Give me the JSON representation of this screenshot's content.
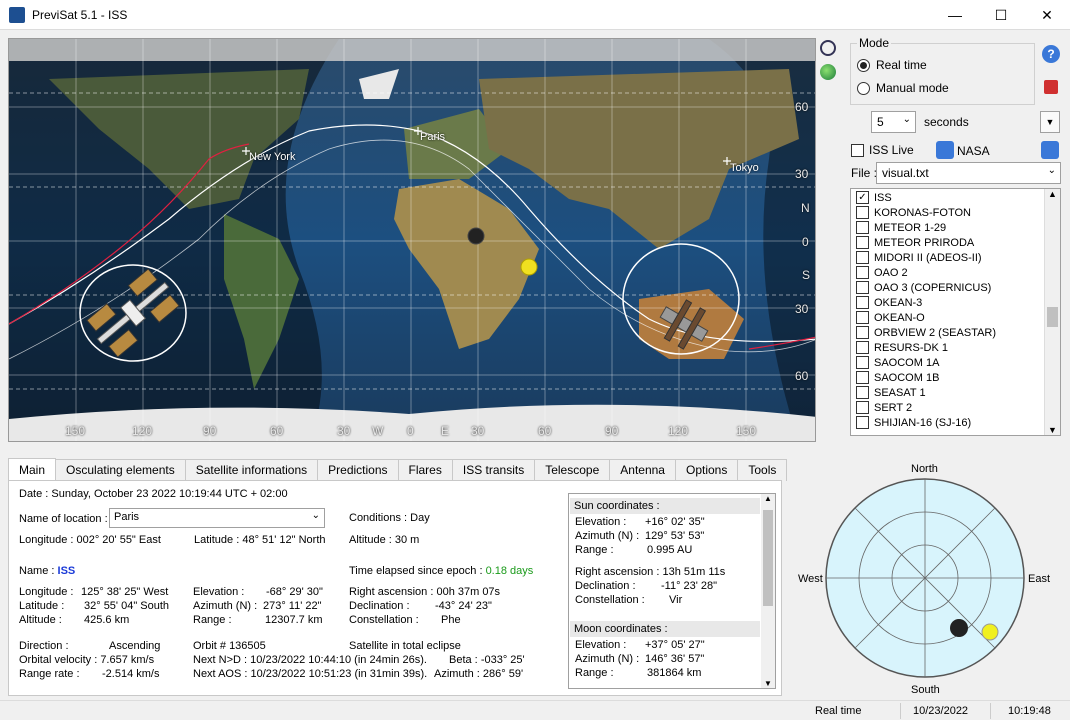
{
  "window": {
    "title": "PreviSat 5.1 - ISS",
    "minimize": "—",
    "maximize": "☐",
    "close": "✕"
  },
  "map": {
    "lon_ticks": [
      "150",
      "120",
      "90",
      "60",
      "30",
      "W",
      "0",
      "E",
      "30",
      "60",
      "90",
      "120",
      "150"
    ],
    "lat_ticks": [
      "60",
      "30",
      "N",
      "0",
      "S",
      "30",
      "60"
    ],
    "cities": [
      {
        "name": "New York"
      },
      {
        "name": "Paris"
      },
      {
        "name": "Tokyo"
      }
    ]
  },
  "mode": {
    "label": "Mode",
    "real_time": "Real time",
    "manual": "Manual mode"
  },
  "step": {
    "value": "5",
    "unit": "seconds"
  },
  "iss_live": "ISS Live",
  "nasa": "NASA",
  "file": {
    "label": "File :",
    "value": "visual.txt"
  },
  "satellites": [
    {
      "name": "ISS",
      "checked": true
    },
    {
      "name": "KORONAS-FOTON"
    },
    {
      "name": "METEOR 1-29"
    },
    {
      "name": "METEOR PRIRODA"
    },
    {
      "name": "MIDORI II (ADEOS-II)"
    },
    {
      "name": "OAO 2"
    },
    {
      "name": "OAO 3 (COPERNICUS)"
    },
    {
      "name": "OKEAN-3"
    },
    {
      "name": "OKEAN-O"
    },
    {
      "name": "ORBVIEW 2 (SEASTAR)"
    },
    {
      "name": "RESURS-DK 1"
    },
    {
      "name": "SAOCOM 1A"
    },
    {
      "name": "SAOCOM 1B"
    },
    {
      "name": "SEASAT 1"
    },
    {
      "name": "SERT 2"
    },
    {
      "name": "SHIJIAN-16 (SJ-16)"
    }
  ],
  "tabs": [
    "Main",
    "Osculating elements",
    "Satellite informations",
    "Predictions",
    "Flares",
    "ISS transits",
    "Telescope",
    "Antenna",
    "Options",
    "Tools"
  ],
  "main": {
    "date_label": "Date :",
    "date": "Sunday, October 23 2022  10:19:44  UTC + 02:00",
    "location_label": "Name of location :",
    "location": "Paris",
    "conditions_label": "Conditions :",
    "conditions": "Day",
    "longitude_label": "Longitude :",
    "longitude": "002° 20' 55\" East",
    "latitude_label": "Latitude :",
    "latitude": "48° 51' 12\" North",
    "altitude_label": "Altitude :",
    "altitude": "30 m",
    "name_label": "Name :",
    "name": "ISS",
    "elapsed_label": "Time elapsed since epoch :",
    "elapsed": "0.18 days",
    "sat_lon_label": "Longitude :",
    "sat_lon": "125° 38' 25\" West",
    "sat_lat_label": "Latitude :",
    "sat_lat": "32° 55' 04\" South",
    "sat_alt_label": "Altitude :",
    "sat_alt": "425.6 km",
    "elev_label": "Elevation :",
    "elev": "-68° 29' 30\"",
    "azim_label": "Azimuth (N) :",
    "azim": "273° 11' 22\"",
    "range_label": "Range :",
    "range": "12307.7 km",
    "ra_label": "Right ascension :",
    "ra": "00h 37m 07s",
    "decl_label": "Declination :",
    "decl": "-43° 24' 23\"",
    "const_label": "Constellation :",
    "const": "Phe",
    "direction_label": "Direction :",
    "direction": "Ascending",
    "orbvel_label": "Orbital velocity :",
    "orbvel": "7.657 km/s",
    "rrate_label": "Range rate :",
    "rrate": "-2.514 km/s",
    "orbit": "Orbit # 136505",
    "eclipse": "Satellite in total eclipse",
    "next_nd_label": "Next N>D :",
    "next_nd": "10/23/2022 10:44:10",
    "next_nd_in": "(in 24min 26s).",
    "beta_label": "Beta :",
    "beta": "-033° 25'",
    "next_aos_label": "Next AOS :",
    "next_aos": "10/23/2022 10:51:23",
    "next_aos_in": "(in 31min 39s).",
    "aos_az_label": "Azimuth :",
    "aos_az": "286° 59'"
  },
  "sun": {
    "header": "Sun coordinates :",
    "elev_label": "Elevation :",
    "elev": "+16° 02' 35\"",
    "azim_label": "Azimuth (N) :",
    "azim": "129° 53' 53\"",
    "range_label": "Range :",
    "range": "0.995 AU",
    "ra_label": "Right ascension :",
    "ra": "13h 51m 11s",
    "decl_label": "Declination :",
    "decl": "-11° 23' 28\"",
    "const_label": "Constellation :",
    "const": "Vir"
  },
  "moon": {
    "header": "Moon coordinates :",
    "elev_label": "Elevation :",
    "elev": "+37° 05' 27\"",
    "azim_label": "Azimuth (N) :",
    "azim": "146° 36' 57\"",
    "range_label": "Range :",
    "range": "381864 km"
  },
  "sky": {
    "north": "North",
    "south": "South",
    "east": "East",
    "west": "West"
  },
  "status": {
    "mode": "Real time",
    "date": "10/23/2022",
    "time": "10:19:48"
  }
}
